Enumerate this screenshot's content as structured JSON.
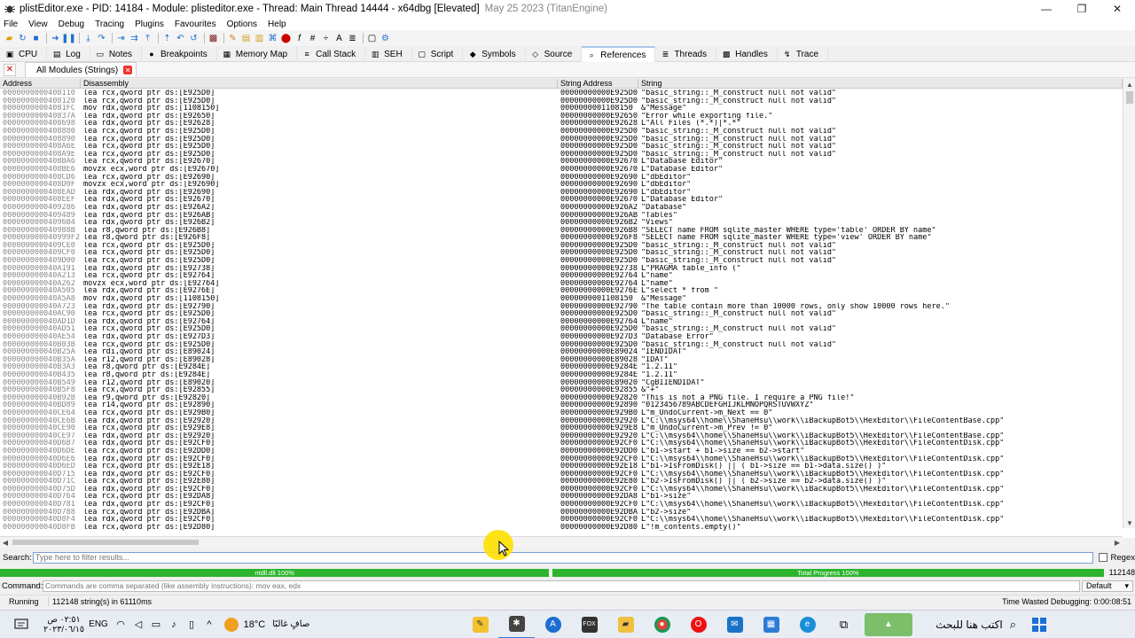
{
  "window": {
    "title": "plistEditor.exe - PID: 14184 - Module: plisteditor.exe - Thread: Main Thread 14444 - x64dbg [Elevated]",
    "date": "May 25 2023 (TitanEngine)",
    "minimize": "—",
    "maximize": "❐",
    "close": "✕"
  },
  "menu": [
    "File",
    "View",
    "Debug",
    "Tracing",
    "Plugins",
    "Favourites",
    "Options",
    "Help"
  ],
  "tabs": [
    {
      "label": "CPU",
      "icon": "cpu-icon",
      "glyph": "▣"
    },
    {
      "label": "Log",
      "icon": "log-icon",
      "glyph": "▤"
    },
    {
      "label": "Notes",
      "icon": "notes-icon",
      "glyph": "▭"
    },
    {
      "label": "Breakpoints",
      "icon": "breakpoint-icon",
      "glyph": "●"
    },
    {
      "label": "Memory Map",
      "icon": "memory-map-icon",
      "glyph": "▦"
    },
    {
      "label": "Call Stack",
      "icon": "call-stack-icon",
      "glyph": "≡"
    },
    {
      "label": "SEH",
      "icon": "seh-icon",
      "glyph": "▥"
    },
    {
      "label": "Script",
      "icon": "script-icon",
      "glyph": "▢"
    },
    {
      "label": "Symbols",
      "icon": "symbols-icon",
      "glyph": "◆"
    },
    {
      "label": "Source",
      "icon": "source-icon",
      "glyph": "◇"
    },
    {
      "label": "References",
      "icon": "references-icon",
      "glyph": "⌕"
    },
    {
      "label": "Threads",
      "icon": "threads-icon",
      "glyph": "≣"
    },
    {
      "label": "Handles",
      "icon": "handles-icon",
      "glyph": "▩"
    },
    {
      "label": "Trace",
      "icon": "trace-icon",
      "glyph": "↯"
    }
  ],
  "active_tab": 10,
  "subtab": {
    "label": "All Modules (Strings)"
  },
  "columns": [
    "Address",
    "Disassembly",
    "String Address",
    "String"
  ],
  "rows": [
    [
      "0000000000408110",
      "lea rcx,qword ptr ds:[E925D0]",
      "00000000000E925D0",
      "\"basic_string::_M_construct null not valid\""
    ],
    [
      "0000000000408120",
      "lea rcx,qword ptr ds:[E925D0]",
      "00000000000E925D0",
      "\"basic_string::_M_construct null not valid\""
    ],
    [
      "00000000004081FC",
      "mov rdx,qword ptr ds:[1108150]",
      "0000000001108150",
      "&\"Message\""
    ],
    [
      "000000000040837A",
      "lea rdx,qword ptr ds:[E92650]",
      "00000000000E92650",
      "\"Error while exporting file.\""
    ],
    [
      "0000000000408698",
      "lea rdx,qword ptr ds:[E92628]",
      "00000000000E92628",
      "L\"All Files (*.*)|*.*\""
    ],
    [
      "0000000000408880",
      "lea rcx,qword ptr ds:[E925D0]",
      "00000000000E925D0",
      "\"basic_string::_M_construct null not valid\""
    ],
    [
      "0000000000408890",
      "lea rcx,qword ptr ds:[E925D0]",
      "00000000000E925D0",
      "\"basic_string::_M_construct null not valid\""
    ],
    [
      "0000000000408A6E",
      "lea rcx,qword ptr ds:[E925D0]",
      "00000000000E925D0",
      "\"basic_string::_M_construct null not valid\""
    ],
    [
      "0000000000408A9E",
      "lea rcx,qword ptr ds:[E925D0]",
      "00000000000E925D0",
      "\"basic_string::_M_construct null not valid\""
    ],
    [
      "0000000000408BA6",
      "lea rcx,qword ptr ds:[E92670]",
      "00000000000E92670",
      "L\"Database Editor\""
    ],
    [
      "0000000000408BE6",
      "movzx ecx,word ptr ds:[E92670]",
      "00000000000E92670",
      "L\"Database Editor\""
    ],
    [
      "0000000000408CD6",
      "lea rcx,qword ptr ds:[E92690]",
      "00000000000E92690",
      "L\"dbEditor\""
    ],
    [
      "0000000000408D0F",
      "movzx ecx,word ptr ds:[E92690]",
      "00000000000E92690",
      "L\"dbEditor\""
    ],
    [
      "0000000000408EAD",
      "lea rdx,qword ptr ds:[E92690]",
      "00000000000E92690",
      "L\"dbEditor\""
    ],
    [
      "0000000000408EEF",
      "lea rdx,qword ptr ds:[E92670]",
      "00000000000E92670",
      "L\"Database Editor\""
    ],
    [
      "0000000000409286",
      "lea rdx,qword ptr ds:[E926A2]",
      "00000000000E926A2",
      "\"Database\""
    ],
    [
      "0000000000409489",
      "lea rdx,qword ptr ds:[E926AB]",
      "00000000000E926AB",
      "\"Tables\""
    ],
    [
      "00000000004096B4",
      "lea rdx,qword ptr ds:[E926B2]",
      "00000000000E926B2",
      "\"Views\""
    ],
    [
      "000000000040988B",
      "lea r8,qword ptr ds:[E926B8]",
      "00000000000E926B8",
      "\"SELECT name FROM sqlite_master WHERE type='table' ORDER BY name\""
    ],
    [
      "000000000040999F2",
      "lea r8,qword ptr ds:[E926F8]",
      "00000000000E926F8",
      "\"SELECT name FROM sqlite_master WHERE type='view' ORDER BY name\""
    ],
    [
      "0000000000409CE0",
      "lea rcx,qword ptr ds:[E925D0]",
      "00000000000E925D0",
      "\"basic_string::_M_construct null not valid\""
    ],
    [
      "0000000000409CF0",
      "lea rcx,qword ptr ds:[E925D0]",
      "00000000000E925D0",
      "\"basic_string::_M_construct null not valid\""
    ],
    [
      "0000000000409D00",
      "lea rcx,qword ptr ds:[E925D0]",
      "00000000000E925D0",
      "\"basic_string::_M_construct null not valid\""
    ],
    [
      "000000000040A191",
      "lea rdx,qword ptr ds:[E92738]",
      "00000000000E92738",
      "L\"PRAGMA table_info (\""
    ],
    [
      "000000000040A213",
      "lea rcx,qword ptr ds:[E92764]",
      "00000000000E92764",
      "L\"name\""
    ],
    [
      "000000000040A262",
      "movzx ecx,word ptr ds:[E92764]",
      "00000000000E92764",
      "L\"name\""
    ],
    [
      "000000000040A505",
      "lea rdx,qword ptr ds:[E9276E]",
      "00000000000E9276E",
      "L\"select * from \""
    ],
    [
      "000000000040A5A8",
      "mov rdx,qword ptr ds:[1108150]",
      "0000000001108150",
      "&\"Message\""
    ],
    [
      "000000000040A723",
      "lea rdx,qword ptr ds:[E92790]",
      "00000000000E92790",
      "\"The table contain more than 10000 rows, only show 10000 rows here.\""
    ],
    [
      "000000000040AC90",
      "lea rcx,qword ptr ds:[E925D0]",
      "00000000000E925D0",
      "\"basic_string::_M_construct null not valid\""
    ],
    [
      "000000000040AD1D",
      "lea rdx,qword ptr ds:[E92764]",
      "00000000000E92764",
      "L\"name\""
    ],
    [
      "000000000040AD51",
      "lea rcx,qword ptr ds:[E925D0]",
      "00000000000E925D0",
      "\"basic_string::_M_construct null not valid\""
    ],
    [
      "000000000040AE54",
      "lea rdx,qword ptr ds:[E927D3]",
      "00000000000E927D3",
      "\"Database Error\""
    ],
    [
      "000000000040B03B",
      "lea rcx,qword ptr ds:[E925D0]",
      "00000000000E925D0",
      "\"basic_string::_M_construct null not valid\""
    ],
    [
      "000000000040B25A",
      "lea rdi,qword ptr ds:[E89024]",
      "00000000000E89024",
      "\"IENDIDAT\""
    ],
    [
      "000000000040B35A",
      "lea r12,qword ptr ds:[E89028]",
      "00000000000E89028",
      "\"IDAT\""
    ],
    [
      "000000000040B3A3",
      "lea r8,qword ptr ds:[E9284E]",
      "00000000000E9284E",
      "\"1.2.11\""
    ],
    [
      "000000000040B435",
      "lea r8,qword ptr ds:[E9284E]",
      "00000000000E9284E",
      "\"1.2.11\""
    ],
    [
      "000000000040B549",
      "lea r12,qword ptr ds:[E89020]",
      "00000000000E89020",
      "\"CgBIIENDIDAT\""
    ],
    [
      "000000000040B5F8",
      "lea rcx,qword ptr ds:[E92855]",
      "00000000000E92855",
      "&\"+\""
    ],
    [
      "000000000040B92B",
      "lea r9,qword ptr ds:[E92820]",
      "00000000000E92820",
      "\"This is not a PNG file. I require a PNG file!\""
    ],
    [
      "000000000040BD89",
      "lea r14,qword ptr ds:[E92890]",
      "00000000000E92890",
      "\"0123456789ABCDEFGHIJKLMNOPQRSTUVWXYZ\""
    ],
    [
      "000000000040CE64",
      "lea rcx,qword ptr ds:[E929B0]",
      "00000000000E929B0",
      "L\"m_UndoCurrent->m_Next == 0\""
    ],
    [
      "000000000040CE6B",
      "lea rdx,qword ptr ds:[E92920]",
      "00000000000E92920",
      "L\"C:\\\\msys64\\\\home\\\\ShaneHsu\\\\work\\\\iBackupBot5\\\\HexEditor\\\\FileContentBase.cpp\""
    ],
    [
      "000000000040CE90",
      "lea rcx,qword ptr ds:[E929E8]",
      "00000000000E929E8",
      "L\"m_UndoCurrent->m_Prev != 0\""
    ],
    [
      "000000000040CE97",
      "lea rdx,qword ptr ds:[E92920]",
      "00000000000E92920",
      "L\"C:\\\\msys64\\\\home\\\\ShaneHsu\\\\work\\\\iBackupBot5\\\\HexEditor\\\\FileContentBase.cpp\""
    ],
    [
      "000000000040D6B7",
      "lea rdx,qword ptr ds:[E92CF0]",
      "00000000000E92CF0",
      "L\"C:\\\\msys64\\\\home\\\\ShaneHsu\\\\work\\\\iBackupBot5\\\\HexEditor\\\\FileContentDisk.cpp\""
    ],
    [
      "000000000040D6DE",
      "lea rcx,qword ptr ds:[E92DD0]",
      "00000000000E92DD0",
      "L\"b1->start + b1->size == b2->start\""
    ],
    [
      "000000000040D6E6",
      "lea rdx,qword ptr ds:[E92CF0]",
      "00000000000E92CF0",
      "L\"C:\\\\msys64\\\\home\\\\ShaneHsu\\\\work\\\\iBackupBot5\\\\HexEditor\\\\FileContentDisk.cpp\""
    ],
    [
      "000000000040D6ED",
      "lea rcx,qword ptr ds:[E92E18]",
      "00000000000E92E18",
      "L\"b1->IsFromDisk() || ( b1->size == b1->data.size() )\""
    ],
    [
      "000000000040D715",
      "lea rdx,qword ptr ds:[E92CF0]",
      "00000000000E92CF0",
      "L\"C:\\\\msys64\\\\home\\\\ShaneHsu\\\\work\\\\iBackupBot5\\\\HexEditor\\\\FileContentDisk.cpp\""
    ],
    [
      "000000000040D71C",
      "lea rcx,qword ptr ds:[E92E80]",
      "00000000000E92E80",
      "L\"b2->IsFromDisk() || ( b2->size == b2->data.size() )\""
    ],
    [
      "000000000040D75D",
      "lea rdx,qword ptr ds:[E92CF0]",
      "00000000000E92CF0",
      "L\"C:\\\\msys64\\\\home\\\\ShaneHsu\\\\work\\\\iBackupBot5\\\\HexEditor\\\\FileContentDisk.cpp\""
    ],
    [
      "000000000040D764",
      "lea rcx,qword ptr ds:[E92DA8]",
      "00000000000E92DA8",
      "L\"b1->size\""
    ],
    [
      "000000000040D781",
      "lea rdx,qword ptr ds:[E92CF0]",
      "00000000000E92CF0",
      "L\"C:\\\\msys64\\\\home\\\\ShaneHsu\\\\work\\\\iBackupBot5\\\\HexEditor\\\\FileContentDisk.cpp\""
    ],
    [
      "000000000040D788",
      "lea rcx,qword ptr ds:[E92DBA]",
      "00000000000E92DBA",
      "L\"b2->size\""
    ],
    [
      "000000000040D8F4",
      "lea rdx,qword ptr ds:[E92CF0]",
      "00000000000E92CF0",
      "L\"C:\\\\msys64\\\\home\\\\ShaneHsu\\\\work\\\\iBackupBot5\\\\HexEditor\\\\FileContentDisk.cpp\""
    ],
    [
      "000000000040D8FB",
      "lea rcx,qword ptr ds:[E92D80]",
      "00000000000E92D80",
      "L\"!m_contents.empty()\""
    ]
  ],
  "search": {
    "label": "Search:",
    "placeholder": "Type here to filter results...",
    "regex_label": "Regex"
  },
  "progress": {
    "left_label": "ntdll.dll 100%",
    "right_label": "Total Progress 100%",
    "count": "112148",
    "left_pct": 100,
    "right_pct": 100,
    "color": "#2cb52c"
  },
  "command": {
    "label": "Command:",
    "placeholder": "Commands are comma separated (like assembly instructions): mov eax, edx",
    "mode": "Default"
  },
  "status": {
    "state": "Running",
    "message": "112148 string(s) in 61110ms",
    "time_wasted": "Time Wasted Debugging: 0:00:08:51"
  },
  "taskbar": {
    "clock_time": "٠٢:٥١ ص",
    "clock_date": "٢٠٢٣/٠٦/١٥",
    "lang": "ENG",
    "weather_temp": "18°C",
    "weather_text": "صافٍ غالبًا",
    "search_text": "اكتب هنا للبحث"
  }
}
